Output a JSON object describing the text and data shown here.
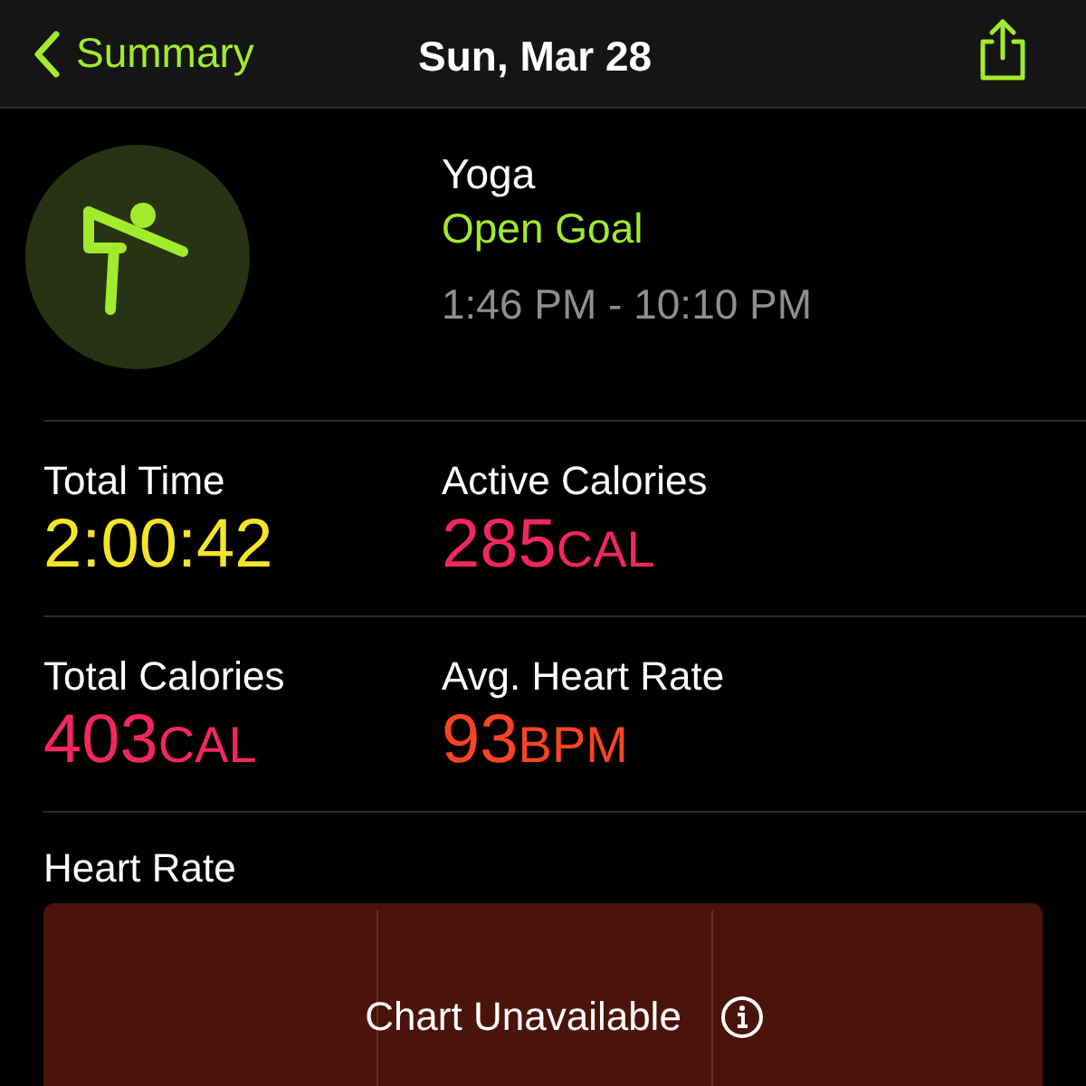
{
  "nav": {
    "back": "Summary",
    "title": "Sun, Mar 28"
  },
  "workout": {
    "name": "Yoga",
    "goal": "Open Goal",
    "time_range": "1:46 PM - 10:10 PM"
  },
  "metrics": [
    {
      "label": "Total Time",
      "value": "2:00:42",
      "color": "#f5e52a"
    },
    {
      "label": "Active Calories",
      "value": "285",
      "unit": "CAL",
      "color": "#f2275f"
    },
    {
      "label": "Total Calories",
      "value": "403",
      "unit": "CAL",
      "color": "#f2275f"
    },
    {
      "label": "Avg. Heart Rate",
      "value": "93",
      "unit": "BPM",
      "color": "#fb4424"
    }
  ],
  "heart_rate": {
    "title": "Heart Rate",
    "message": "Chart Unavailable"
  }
}
